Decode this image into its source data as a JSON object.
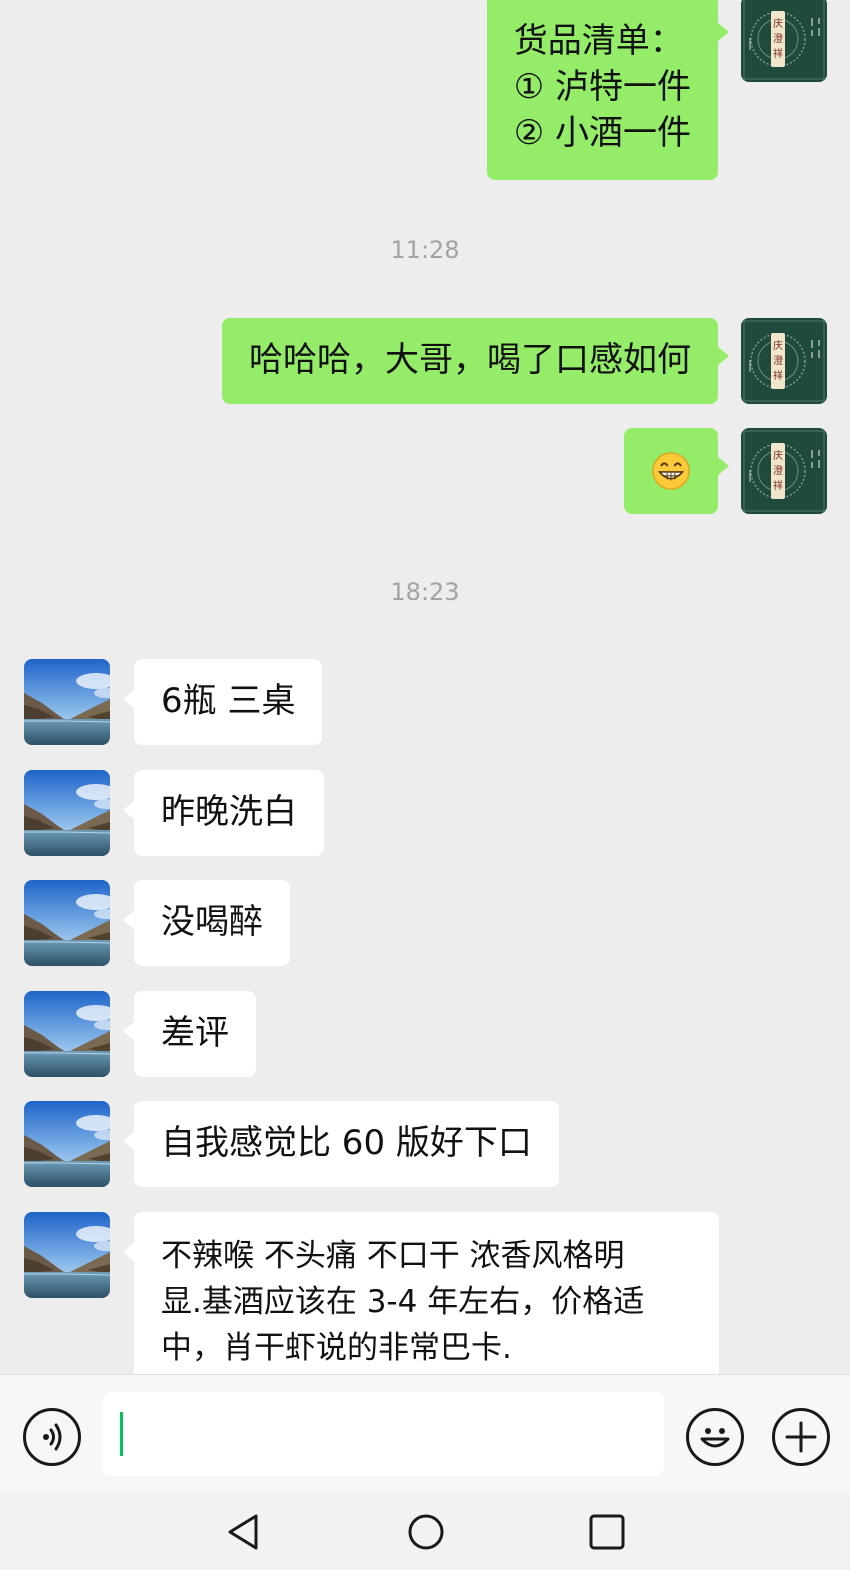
{
  "messages": {
    "m1": {
      "lines": [
        "货品清单：",
        "① 泸特一件",
        "② 小酒一件"
      ]
    },
    "t1": "11:28",
    "m2": "哈哈哈，大哥，喝了口感如何",
    "m3_emoji": "grinning-face-emoji",
    "t2": "18:23",
    "r1": "6瓶 三桌",
    "r2": "昨晚洗白",
    "r3": "没喝醉",
    "r4": "差评",
    "r5": "自我感觉比 60 版好下口",
    "r6": {
      "lines": [
        "不辣喉 不头痛 不口干 浓香风格明",
        "显.基酒应该在 3-4 年左右，价格适",
        "中，肖干虾说的非常巴卡."
      ]
    }
  },
  "avatars": {
    "self": "dark-green-seal-avatar",
    "other": "mountain-lake-landscape-avatar"
  },
  "input": {
    "value": ""
  },
  "icons": {
    "voice": "voice-icon",
    "emoji": "emoji-icon",
    "plus": "plus-icon",
    "back": "back-triangle-icon",
    "home": "home-circle-icon",
    "recent": "recent-square-icon"
  },
  "colors": {
    "self_bubble": "#95ec69",
    "other_bubble": "#ffffff",
    "background": "#ededed",
    "caret": "#07c160"
  }
}
